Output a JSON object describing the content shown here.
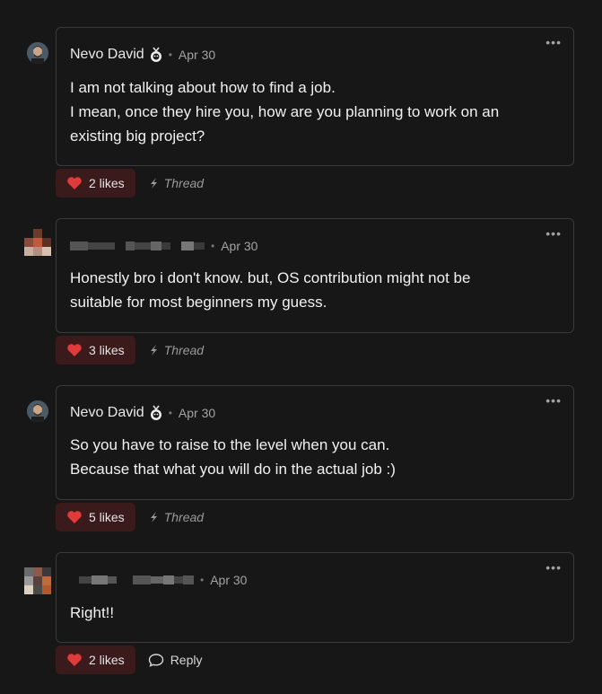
{
  "comments": [
    {
      "author": "Nevo David",
      "date": "Apr 30",
      "lines": [
        "I am not talking about how to find a job.",
        "I mean, once they hire you, how are you planning to work on an",
        "existing big project?"
      ],
      "likes": "2 likes",
      "secondary": "Thread"
    },
    {
      "author": "",
      "date": "Apr 30",
      "lines": [
        "Honestly bro i don't know. but, OS contribution might not be",
        "suitable for most beginners my guess."
      ],
      "likes": "3 likes",
      "secondary": "Thread"
    },
    {
      "author": "Nevo David",
      "date": "Apr 30",
      "lines": [
        "So you have to raise to the level when you can.",
        "Because that what you will do in the actual job :)"
      ],
      "likes": "5 likes",
      "secondary": "Thread"
    },
    {
      "author": "",
      "date": "Apr 30",
      "lines": [
        "Right!!"
      ],
      "likes": "2 likes",
      "secondary": "Reply"
    }
  ],
  "ui": {
    "more_label": "•••",
    "separator": "•"
  },
  "icons": {
    "heart": "heart-icon",
    "thread": "thread-icon",
    "reply": "reply-icon",
    "more": "more-icon",
    "badge": "sloth-badge-icon"
  },
  "colors": {
    "background": "#171717",
    "card_border": "#3a3a3a",
    "like_bg": "#3a1a1a",
    "heart": "#e03a3a"
  }
}
